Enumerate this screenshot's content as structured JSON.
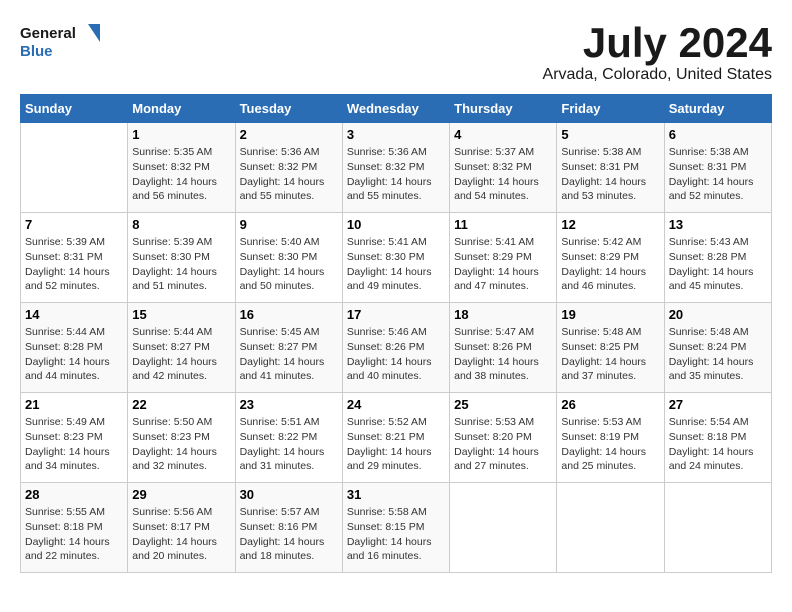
{
  "header": {
    "logo_line1": "General",
    "logo_line2": "Blue",
    "month": "July 2024",
    "location": "Arvada, Colorado, United States"
  },
  "days_of_week": [
    "Sunday",
    "Monday",
    "Tuesday",
    "Wednesday",
    "Thursday",
    "Friday",
    "Saturday"
  ],
  "weeks": [
    [
      {
        "day": null,
        "info": ""
      },
      {
        "day": "1",
        "info": "Sunrise: 5:35 AM\nSunset: 8:32 PM\nDaylight: 14 hours\nand 56 minutes."
      },
      {
        "day": "2",
        "info": "Sunrise: 5:36 AM\nSunset: 8:32 PM\nDaylight: 14 hours\nand 55 minutes."
      },
      {
        "day": "3",
        "info": "Sunrise: 5:36 AM\nSunset: 8:32 PM\nDaylight: 14 hours\nand 55 minutes."
      },
      {
        "day": "4",
        "info": "Sunrise: 5:37 AM\nSunset: 8:32 PM\nDaylight: 14 hours\nand 54 minutes."
      },
      {
        "day": "5",
        "info": "Sunrise: 5:38 AM\nSunset: 8:31 PM\nDaylight: 14 hours\nand 53 minutes."
      },
      {
        "day": "6",
        "info": "Sunrise: 5:38 AM\nSunset: 8:31 PM\nDaylight: 14 hours\nand 52 minutes."
      }
    ],
    [
      {
        "day": "7",
        "info": "Sunrise: 5:39 AM\nSunset: 8:31 PM\nDaylight: 14 hours\nand 52 minutes."
      },
      {
        "day": "8",
        "info": "Sunrise: 5:39 AM\nSunset: 8:30 PM\nDaylight: 14 hours\nand 51 minutes."
      },
      {
        "day": "9",
        "info": "Sunrise: 5:40 AM\nSunset: 8:30 PM\nDaylight: 14 hours\nand 50 minutes."
      },
      {
        "day": "10",
        "info": "Sunrise: 5:41 AM\nSunset: 8:30 PM\nDaylight: 14 hours\nand 49 minutes."
      },
      {
        "day": "11",
        "info": "Sunrise: 5:41 AM\nSunset: 8:29 PM\nDaylight: 14 hours\nand 47 minutes."
      },
      {
        "day": "12",
        "info": "Sunrise: 5:42 AM\nSunset: 8:29 PM\nDaylight: 14 hours\nand 46 minutes."
      },
      {
        "day": "13",
        "info": "Sunrise: 5:43 AM\nSunset: 8:28 PM\nDaylight: 14 hours\nand 45 minutes."
      }
    ],
    [
      {
        "day": "14",
        "info": "Sunrise: 5:44 AM\nSunset: 8:28 PM\nDaylight: 14 hours\nand 44 minutes."
      },
      {
        "day": "15",
        "info": "Sunrise: 5:44 AM\nSunset: 8:27 PM\nDaylight: 14 hours\nand 42 minutes."
      },
      {
        "day": "16",
        "info": "Sunrise: 5:45 AM\nSunset: 8:27 PM\nDaylight: 14 hours\nand 41 minutes."
      },
      {
        "day": "17",
        "info": "Sunrise: 5:46 AM\nSunset: 8:26 PM\nDaylight: 14 hours\nand 40 minutes."
      },
      {
        "day": "18",
        "info": "Sunrise: 5:47 AM\nSunset: 8:26 PM\nDaylight: 14 hours\nand 38 minutes."
      },
      {
        "day": "19",
        "info": "Sunrise: 5:48 AM\nSunset: 8:25 PM\nDaylight: 14 hours\nand 37 minutes."
      },
      {
        "day": "20",
        "info": "Sunrise: 5:48 AM\nSunset: 8:24 PM\nDaylight: 14 hours\nand 35 minutes."
      }
    ],
    [
      {
        "day": "21",
        "info": "Sunrise: 5:49 AM\nSunset: 8:23 PM\nDaylight: 14 hours\nand 34 minutes."
      },
      {
        "day": "22",
        "info": "Sunrise: 5:50 AM\nSunset: 8:23 PM\nDaylight: 14 hours\nand 32 minutes."
      },
      {
        "day": "23",
        "info": "Sunrise: 5:51 AM\nSunset: 8:22 PM\nDaylight: 14 hours\nand 31 minutes."
      },
      {
        "day": "24",
        "info": "Sunrise: 5:52 AM\nSunset: 8:21 PM\nDaylight: 14 hours\nand 29 minutes."
      },
      {
        "day": "25",
        "info": "Sunrise: 5:53 AM\nSunset: 8:20 PM\nDaylight: 14 hours\nand 27 minutes."
      },
      {
        "day": "26",
        "info": "Sunrise: 5:53 AM\nSunset: 8:19 PM\nDaylight: 14 hours\nand 25 minutes."
      },
      {
        "day": "27",
        "info": "Sunrise: 5:54 AM\nSunset: 8:18 PM\nDaylight: 14 hours\nand 24 minutes."
      }
    ],
    [
      {
        "day": "28",
        "info": "Sunrise: 5:55 AM\nSunset: 8:18 PM\nDaylight: 14 hours\nand 22 minutes."
      },
      {
        "day": "29",
        "info": "Sunrise: 5:56 AM\nSunset: 8:17 PM\nDaylight: 14 hours\nand 20 minutes."
      },
      {
        "day": "30",
        "info": "Sunrise: 5:57 AM\nSunset: 8:16 PM\nDaylight: 14 hours\nand 18 minutes."
      },
      {
        "day": "31",
        "info": "Sunrise: 5:58 AM\nSunset: 8:15 PM\nDaylight: 14 hours\nand 16 minutes."
      },
      {
        "day": null,
        "info": ""
      },
      {
        "day": null,
        "info": ""
      },
      {
        "day": null,
        "info": ""
      }
    ]
  ]
}
